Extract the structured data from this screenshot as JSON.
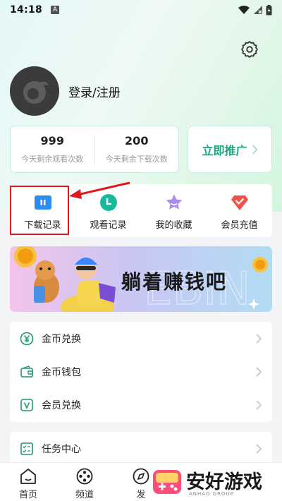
{
  "status_bar": {
    "time": "14:18",
    "notification_icon": "A"
  },
  "profile": {
    "login_label": "登录/注册"
  },
  "stats": [
    {
      "value": "999",
      "label": "今天剩余观看次数"
    },
    {
      "value": "200",
      "label": "今天剩余下载次数"
    }
  ],
  "promote": {
    "label": "立即推广"
  },
  "quick_actions": [
    {
      "label": "下载记录",
      "icon": "download-record-icon"
    },
    {
      "label": "观看记录",
      "icon": "watch-history-icon"
    },
    {
      "label": "我的收藏",
      "icon": "favorites-star-icon"
    },
    {
      "label": "会员充值",
      "icon": "vip-recharge-icon"
    }
  ],
  "banner": {
    "text": "躺着赚钱吧"
  },
  "menu": [
    {
      "label": "金币兑换",
      "icon": "coin-exchange-icon"
    },
    {
      "label": "金币钱包",
      "icon": "wallet-icon"
    },
    {
      "label": "会员兑换",
      "icon": "vip-exchange-icon"
    }
  ],
  "menu2": [
    {
      "label": "任务中心",
      "icon": "task-center-icon"
    }
  ],
  "tabs": [
    {
      "label": "首页",
      "icon": "home-icon"
    },
    {
      "label": "频道",
      "icon": "channel-icon"
    },
    {
      "label": "发",
      "icon": "discover-icon"
    }
  ],
  "watermark": {
    "text": "安好游戏",
    "sub": "ANHAO GROUP"
  },
  "colors": {
    "accent": "#16a980",
    "highlight": "#e0191a"
  }
}
